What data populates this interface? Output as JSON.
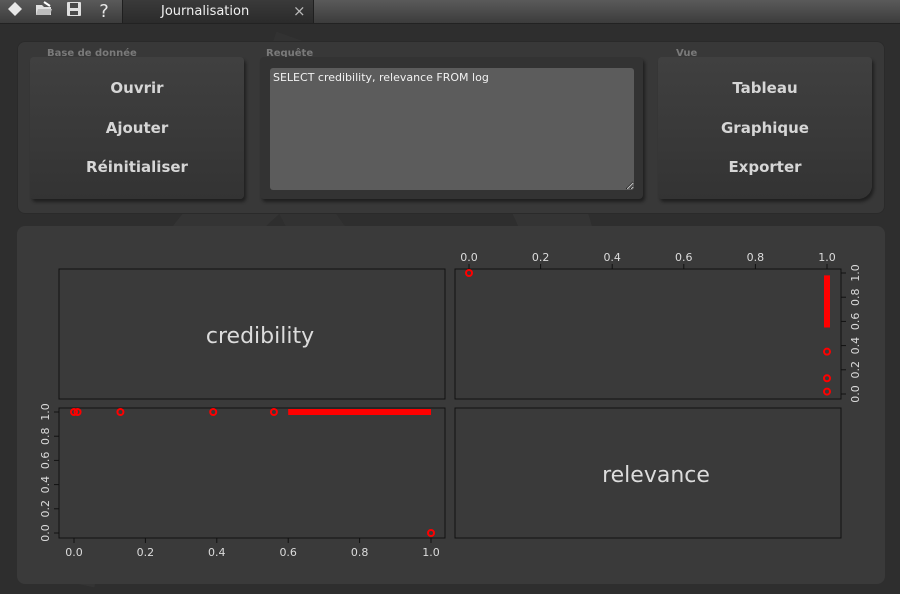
{
  "toolbar": {
    "icons": [
      "diamond-icon",
      "open-folder-icon",
      "save-icon",
      "help-icon"
    ],
    "help_glyph": "?"
  },
  "tab": {
    "title": "Journalisation",
    "close_glyph": "×"
  },
  "database": {
    "label": "Base de donnée",
    "buttons": [
      "Ouvrir",
      "Ajouter",
      "Réinitialiser"
    ]
  },
  "query": {
    "label": "Requête",
    "value": "SELECT credibility, relevance FROM log"
  },
  "view": {
    "label": "Vue",
    "buttons": [
      "Tableau",
      "Graphique",
      "Exporter"
    ]
  },
  "chart_data": {
    "type": "scatter",
    "variables": [
      "credibility",
      "relevance"
    ],
    "tick_labels": [
      "0.0",
      "0.2",
      "0.4",
      "0.6",
      "0.8",
      "1.0"
    ],
    "xlim": [
      0,
      1
    ],
    "ylim": [
      0,
      1
    ],
    "point_color": "#ff0000",
    "panels": [
      {
        "x_var": "relevance",
        "y_var": "credibility",
        "points": [
          [
            0.0,
            1.0
          ],
          [
            0.01,
            1.0
          ],
          [
            0.13,
            1.0
          ],
          [
            0.39,
            1.0
          ],
          [
            0.56,
            1.0
          ],
          [
            1.0,
            0.0
          ]
        ],
        "runs": [
          [
            0.6,
            1.0,
            1.0
          ]
        ]
      },
      {
        "x_var": "credibility",
        "y_var": "relevance",
        "points": [
          [
            0.0,
            1.0
          ],
          [
            1.0,
            0.02
          ],
          [
            1.0,
            0.13
          ],
          [
            1.0,
            0.35
          ]
        ],
        "runs_vertical": [
          [
            1.0,
            0.55,
            0.98
          ]
        ]
      }
    ]
  }
}
